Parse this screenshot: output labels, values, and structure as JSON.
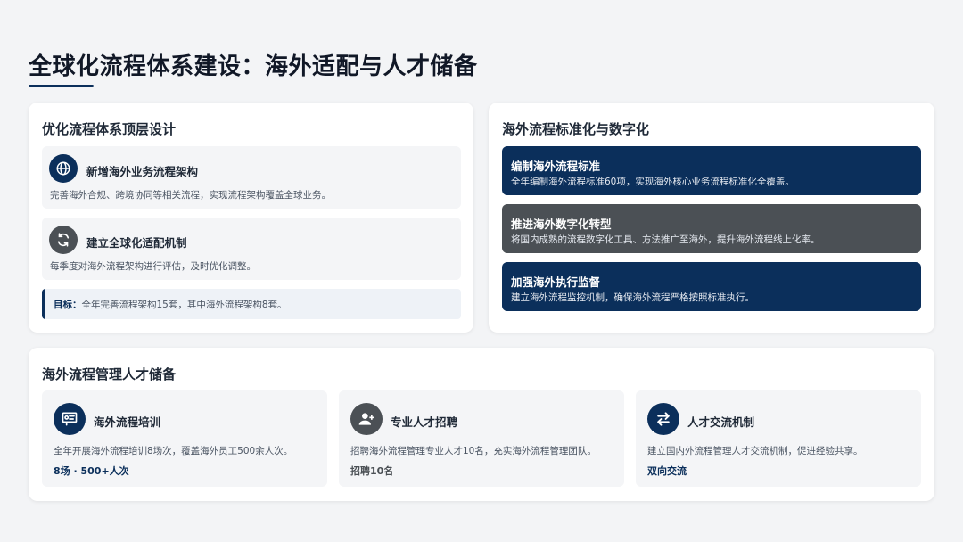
{
  "page": {
    "title": "全球化流程体系建设：海外适配与人才储备"
  },
  "colors": {
    "navy": "#0b2f5b",
    "gray_card": "#4b5055",
    "icon_gray": "#4b5055",
    "background": "#f3f4f6"
  },
  "top_design": {
    "heading": "优化流程体系顶层设计",
    "items": [
      {
        "icon": "globe-icon",
        "title": "新增海外业务流程架构",
        "desc": "完善海外合规、跨境协同等相关流程，实现流程架构覆盖全球业务。"
      },
      {
        "icon": "refresh-icon",
        "title": "建立全球化适配机制",
        "desc": "每季度对海外流程架构进行评估，及时优化调整。"
      }
    ],
    "goal_label": "目标：",
    "goal_text": "全年完善流程架构15套，其中海外流程架构8套。"
  },
  "standardization": {
    "heading": "海外流程标准化与数字化",
    "items": [
      {
        "title": "编制海外流程标准",
        "desc": "全年编制海外流程标准60项，实现海外核心业务流程标准化全覆盖。"
      },
      {
        "title": "推进海外数字化转型",
        "desc": "将国内成熟的流程数字化工具、方法推广至海外，提升海外流程线上化率。"
      },
      {
        "title": "加强海外执行监督",
        "desc": "建立海外流程监控机制，确保海外流程严格按照标准执行。"
      }
    ]
  },
  "talent": {
    "heading": "海外流程管理人才储备",
    "items": [
      {
        "icon": "training-icon",
        "title": "海外流程培训",
        "desc": "全年开展海外流程培训8场次，覆盖海外员工500余人次。",
        "stat": "8场 · 500+人次"
      },
      {
        "icon": "add-user-icon",
        "title": "专业人才招聘",
        "desc": "招聘海外流程管理专业人才10名，充实海外流程管理团队。",
        "stat": "招聘10名"
      },
      {
        "icon": "exchange-icon",
        "title": "人才交流机制",
        "desc": "建立国内外流程管理人才交流机制，促进经验共享。",
        "stat": "双向交流"
      }
    ]
  }
}
